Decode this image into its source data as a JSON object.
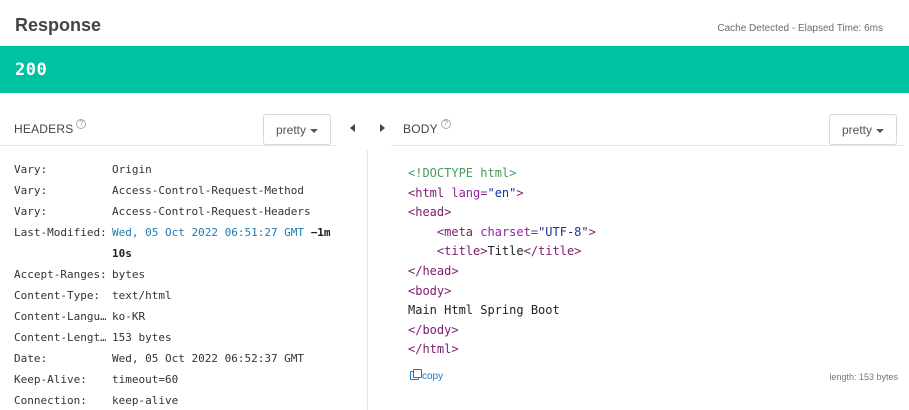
{
  "response": {
    "title": "Response",
    "cache_info": "Cache Detected - Elapsed Time: 6ms",
    "status_code": "200"
  },
  "headers_panel": {
    "title": "HEADERS",
    "help_glyph": "?",
    "format_label": "pretty",
    "rows": [
      {
        "name": "Vary:",
        "value": "Origin"
      },
      {
        "name": "Vary:",
        "value": "Access-Control-Request-Method"
      },
      {
        "name": "Vary:",
        "value": "Access-Control-Request-Headers"
      },
      {
        "name": "Last-Modified:",
        "value": "Wed, 05 Oct 2022 06:51:27 GMT",
        "ago": "−1m",
        "ago_line2": "10s"
      },
      {
        "name": "Accept-Ranges:",
        "value": "bytes"
      },
      {
        "name": "Content-Type:",
        "value": "text/html"
      },
      {
        "name": "Content-Langu…",
        "value": "ko-KR"
      },
      {
        "name": "Content-Lengt…",
        "value": "153 bytes"
      },
      {
        "name": "Date:",
        "value": "Wed, 05 Oct 2022 06:52:37 GMT"
      },
      {
        "name": "Keep-Alive:",
        "value": "timeout=60"
      },
      {
        "name": "Connection:",
        "value": "keep-alive"
      }
    ]
  },
  "body_panel": {
    "title": "BODY",
    "help_glyph": "?",
    "format_label": "pretty",
    "code": {
      "doctype": "<!DOCTYPE html>",
      "html_open": "<html",
      "html_attr": "lang=",
      "html_attr_val": "\"en\"",
      "html_close_bracket": ">",
      "head_open": "<head>",
      "meta_open": "<meta",
      "meta_attr": "charset=",
      "meta_attr_val": "\"UTF-8\"",
      "meta_close": ">",
      "title_open": "<title>",
      "title_text": "Title",
      "title_close": "</title>",
      "head_close": "</head>",
      "body_open": "<body>",
      "body_text": "Main Html Spring Boot",
      "body_close": "</body>",
      "html_close": "</html>"
    },
    "copy_label": "copy",
    "length_info": "length: 153 bytes"
  },
  "colors": {
    "status_bar": "#00c2a2",
    "link": "#1f7ab4",
    "doctype": "#4a9a5b",
    "tag": "#7c1a6f",
    "string": "#1f2f9f"
  },
  "icons": {
    "help": "question-circle-icon",
    "collapse_left": "caret-left-icon",
    "expand_right": "caret-right-icon",
    "copy": "copy-icon",
    "dropdown": "caret-down-icon"
  }
}
